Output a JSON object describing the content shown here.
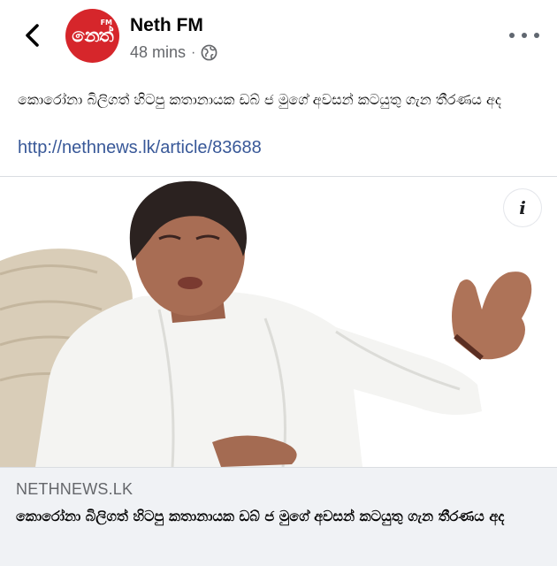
{
  "header": {
    "back_icon": "chevron-left-icon",
    "avatar_text": "නෙත්",
    "avatar_superscript": "FM",
    "avatar_color": "#d6262b",
    "page_name": "Neth FM",
    "time_ago": "48 mins",
    "separator": "·",
    "privacy_icon": "globe-icon",
    "more_icon": "more-dots-icon"
  },
  "post": {
    "text": "කොරෝනා බිලිගත් හිටපු කතානායක ඩබ් ජ මුගේ අවසන් කටයුතු ගැන තීරණය අද",
    "link": "http://nethnews.lk/article/83688",
    "link_color": "#385898"
  },
  "card": {
    "info_label": "i",
    "domain": "NETHNEWS.LK",
    "title": "කොරෝනා බිලිගත් හිටපු කතානායක ඩබ් ජ මුගේ අවසන් කටයුතු ගැන තීරණය අද",
    "footer_bg": "#f0f2f5"
  }
}
